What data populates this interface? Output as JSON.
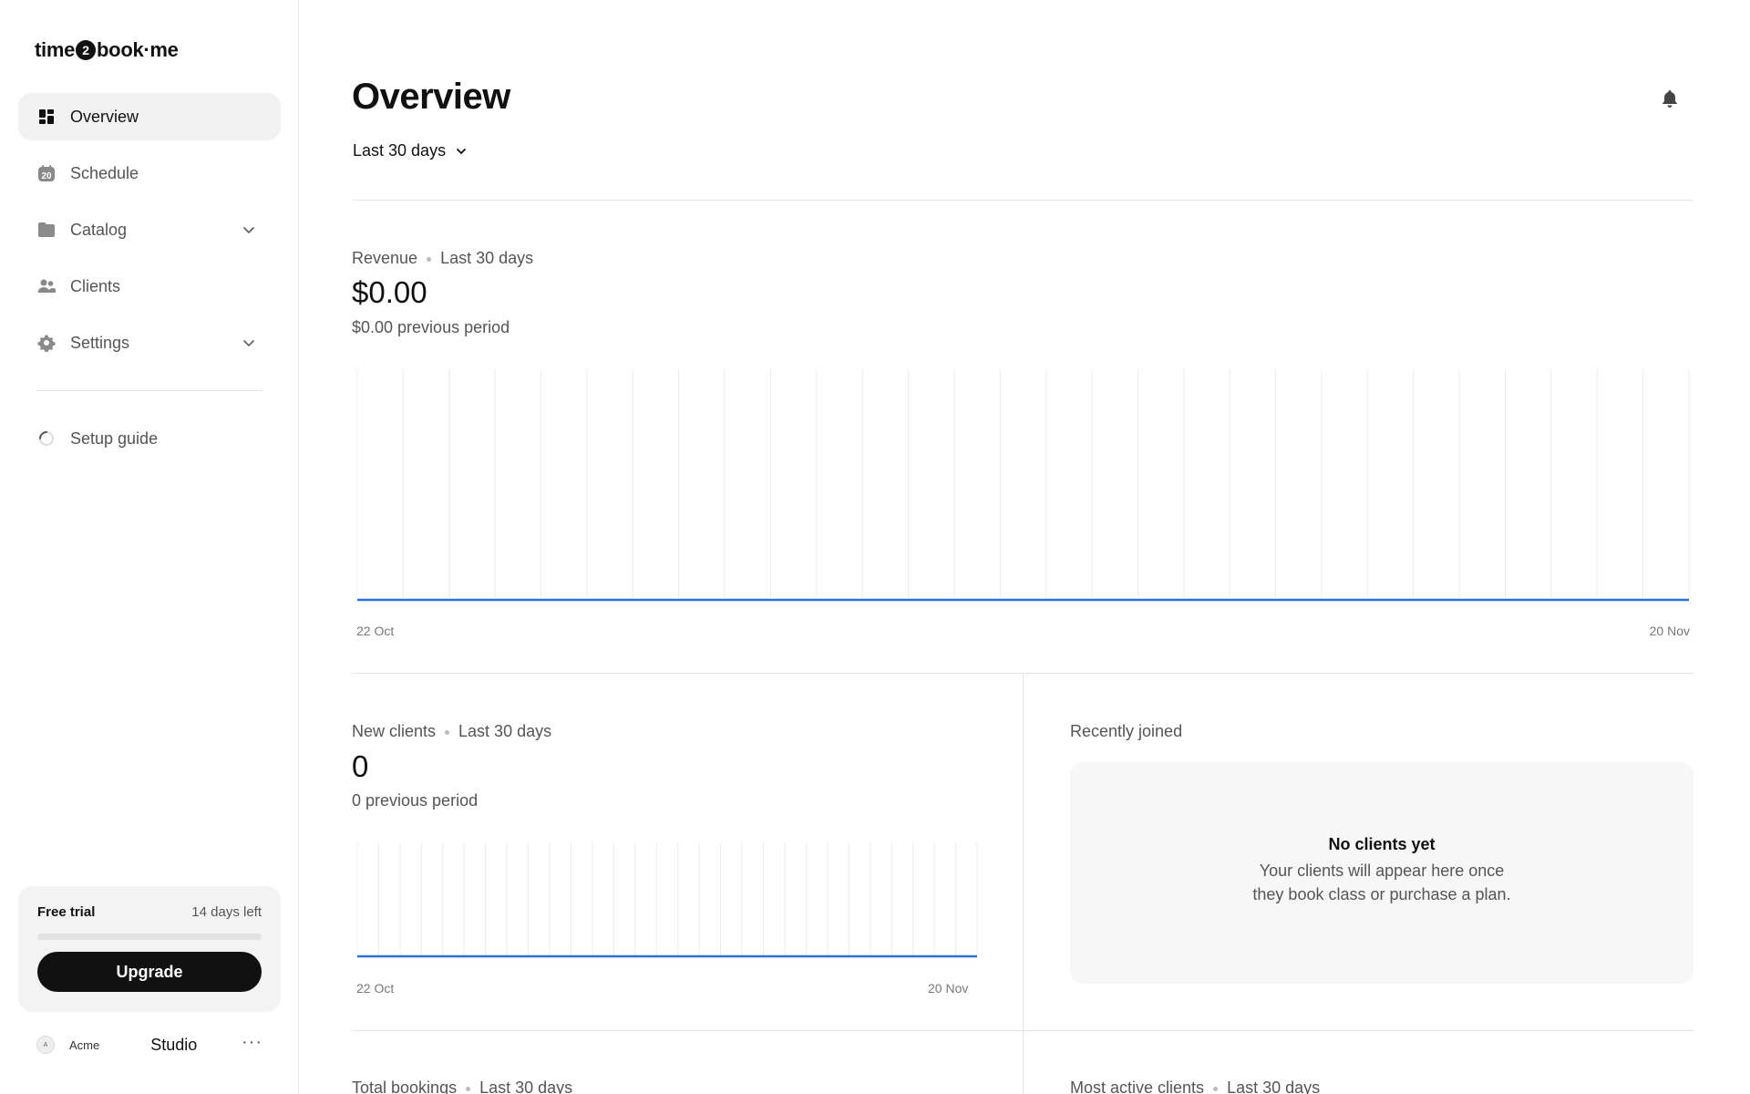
{
  "app": {
    "logo_left": "time",
    "logo_badge": "2",
    "logo_right": "book·me"
  },
  "sidebar": {
    "items": [
      {
        "label": "Overview",
        "icon": "dashboard-icon",
        "active": true
      },
      {
        "label": "Schedule",
        "icon": "calendar-icon",
        "badge": "20"
      },
      {
        "label": "Catalog",
        "icon": "folder-icon",
        "expandable": true
      },
      {
        "label": "Clients",
        "icon": "people-icon"
      },
      {
        "label": "Settings",
        "icon": "gear-icon",
        "expandable": true
      }
    ],
    "setup_guide": {
      "label": "Setup guide",
      "icon": "progress-ring-icon"
    },
    "trial": {
      "title": "Free trial",
      "days_left": "14 days left",
      "progress": 0,
      "upgrade_label": "Upgrade"
    },
    "account": {
      "avatar_text": "A",
      "name": "Acme",
      "workspace": "Studio",
      "more_label": "···"
    }
  },
  "header": {
    "title": "Overview",
    "period": "Last 30 days",
    "bell_icon": "bell-icon"
  },
  "revenue": {
    "label": "Revenue",
    "period": "Last 30 days",
    "value": "$0.00",
    "previous": "$0.00 previous period"
  },
  "new_clients": {
    "label": "New clients",
    "period": "Last 30 days",
    "value": "0",
    "previous": "0 previous period"
  },
  "recently_joined": {
    "label": "Recently joined",
    "empty_title": "No clients yet",
    "empty_line1": "Your clients will appear here once",
    "empty_line2": "they book class or purchase a plan."
  },
  "total_bookings": {
    "label": "Total bookings",
    "period": "Last 30 days"
  },
  "most_active_clients": {
    "label": "Most active clients",
    "period": "Last 30 days"
  },
  "chart_data": [
    {
      "type": "line",
      "title": "Revenue",
      "x_range": [
        "22 Oct",
        "20 Nov"
      ],
      "tick_labels": [
        "22 Oct",
        "20 Nov"
      ],
      "x_count": 30,
      "y_values": [
        0,
        0,
        0,
        0,
        0,
        0,
        0,
        0,
        0,
        0,
        0,
        0,
        0,
        0,
        0,
        0,
        0,
        0,
        0,
        0,
        0,
        0,
        0,
        0,
        0,
        0,
        0,
        0,
        0,
        0
      ],
      "grid": true,
      "color": "#2f6fdd"
    },
    {
      "type": "line",
      "title": "New clients",
      "x_range": [
        "22 Oct",
        "20 Nov"
      ],
      "tick_labels": [
        "22 Oct",
        "20 Nov"
      ],
      "x_count": 30,
      "y_values": [
        0,
        0,
        0,
        0,
        0,
        0,
        0,
        0,
        0,
        0,
        0,
        0,
        0,
        0,
        0,
        0,
        0,
        0,
        0,
        0,
        0,
        0,
        0,
        0,
        0,
        0,
        0,
        0,
        0,
        0
      ],
      "grid": true,
      "color": "#2f6fdd"
    }
  ],
  "colors": {
    "accent": "#2f6fdd",
    "active_bg": "#f2f2f2",
    "divider": "#e6e6e6"
  }
}
